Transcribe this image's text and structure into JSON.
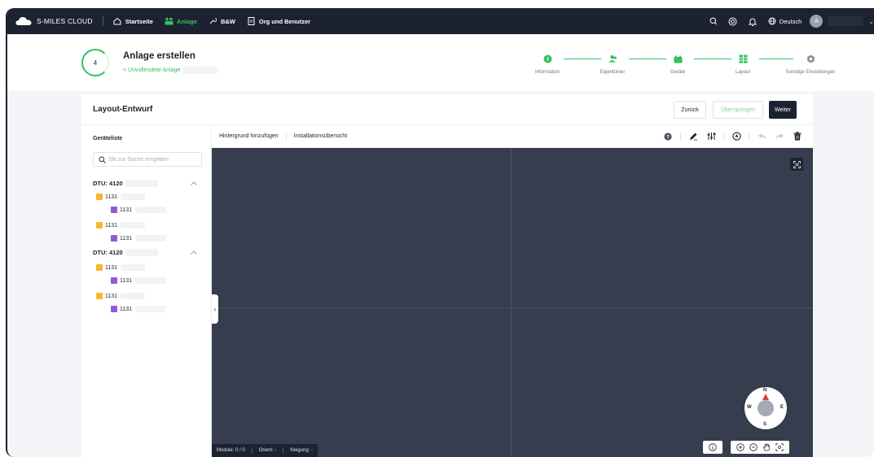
{
  "brand": {
    "name": "S-MILES CLOUD"
  },
  "nav": {
    "items": [
      {
        "label": "Startseite",
        "icon": "home-icon",
        "active": false
      },
      {
        "label": "Anlage",
        "icon": "plant-icon",
        "active": true
      },
      {
        "label": "B&W",
        "icon": "wrench-icon",
        "active": false
      },
      {
        "label": "Org und Benutzer",
        "icon": "document-icon",
        "active": false
      }
    ],
    "language": "Deutsch",
    "avatar_initial": "A"
  },
  "wizard": {
    "step_number": "4",
    "title": "Anlage erstellen",
    "subtitle": "< Unvollendete Anlage",
    "steps": [
      {
        "label": "Information",
        "icon": "check-circle-icon"
      },
      {
        "label": "Eigentümer",
        "icon": "users-icon"
      },
      {
        "label": "Geräte",
        "icon": "device-icon"
      },
      {
        "label": "Layout",
        "icon": "grid-icon"
      },
      {
        "label": "Sonstige Einstellungen",
        "icon": "settings-icon"
      }
    ],
    "colors": {
      "accent": "#33c25e",
      "nav_bg": "#1c2230"
    }
  },
  "layout_card": {
    "title": "Layout-Entwurf",
    "buttons": {
      "back": "Zurück",
      "skip": "Überspringen",
      "next": "Weiter"
    }
  },
  "device_list": {
    "title": "Geräteliste",
    "search_placeholder": "SN zur Suche eingeben",
    "dtus": [
      {
        "label": "DTU: 4120",
        "inverters": [
          {
            "label": "1131",
            "module": "1131"
          },
          {
            "label": "1131",
            "module": "1131"
          }
        ]
      },
      {
        "label": "DTU: 4120",
        "inverters": [
          {
            "label": "1131",
            "module": "1131"
          },
          {
            "label": "1131",
            "module": "1131"
          }
        ]
      }
    ]
  },
  "canvas_toolbar": {
    "add_background": "Hintergrund hinzufügen",
    "installation_overview": "Installationsübersicht"
  },
  "canvas": {
    "background_color": "#353d4e",
    "compass": {
      "n": "N",
      "s": "S",
      "e": "E",
      "w": "W"
    },
    "status": {
      "modules": "Module: 0 / 0",
      "orient": "Orient: -",
      "neigung": "Neigung: -"
    }
  }
}
